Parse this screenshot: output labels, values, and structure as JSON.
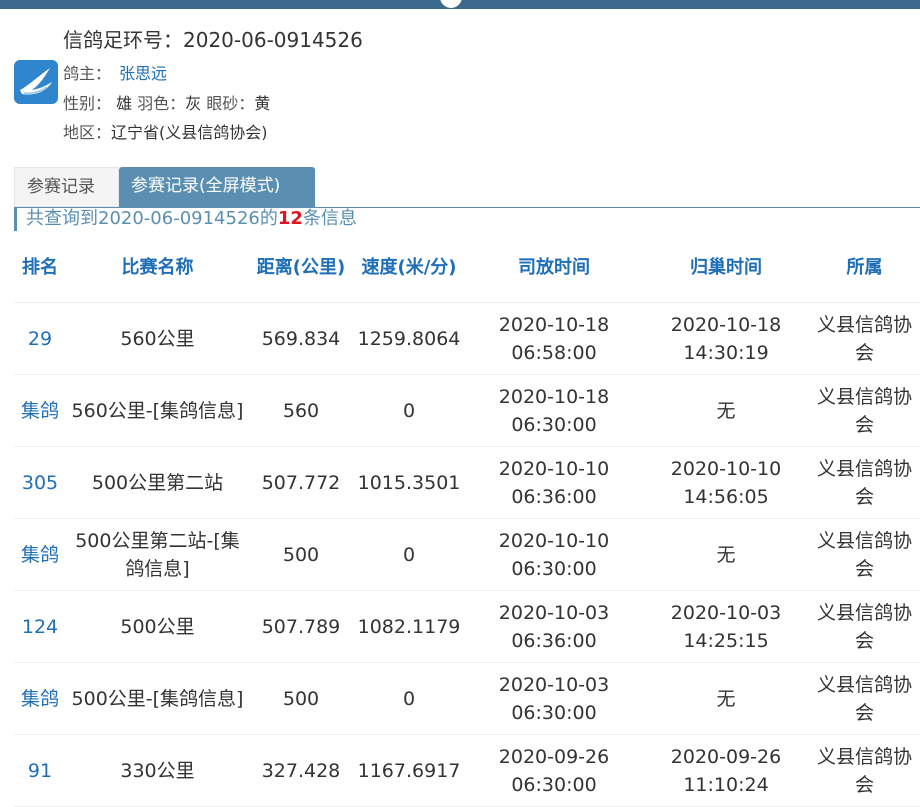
{
  "header": {
    "ring_label": "信鸽足环号：",
    "ring_number": "2020-06-0914526",
    "owner_label": "鸽主：",
    "owner_name": "张思远",
    "sex_label": "性别：",
    "sex_value": "雄",
    "color_label": "羽色：",
    "color_value": "灰",
    "eye_label": "眼砂：",
    "eye_value": "黄",
    "region_label": "地区：",
    "region_value": "辽宁省(义县信鸽协会)",
    "logo_icon": "dove-logo-icon"
  },
  "tabs": [
    {
      "label": "参赛记录",
      "active": false
    },
    {
      "label": "参赛记录(全屏模式)",
      "active": true
    }
  ],
  "query": {
    "prefix": "共查询到2020-06-0914526的",
    "count": "12",
    "suffix": "条信息"
  },
  "table": {
    "columns": [
      "排名",
      "比赛名称",
      "距离(公里)",
      "速度(米/分)",
      "司放时间",
      "归巢时间",
      "所属"
    ],
    "rows": [
      {
        "rank": "29",
        "race": "560公里",
        "distance": "569.834",
        "speed": "1259.8064",
        "release": "2020-10-18 06:58:00",
        "arrival": "2020-10-18 14:30:19",
        "org": "义县信鸽协会"
      },
      {
        "rank": "集鸽",
        "race": "560公里-[集鸽信息]",
        "distance": "560",
        "speed": "0",
        "release": "2020-10-18 06:30:00",
        "arrival": "无",
        "org": "义县信鸽协会"
      },
      {
        "rank": "305",
        "race": "500公里第二站",
        "distance": "507.772",
        "speed": "1015.3501",
        "release": "2020-10-10 06:36:00",
        "arrival": "2020-10-10 14:56:05",
        "org": "义县信鸽协会"
      },
      {
        "rank": "集鸽",
        "race": "500公里第二站-[集鸽信息]",
        "distance": "500",
        "speed": "0",
        "release": "2020-10-10 06:30:00",
        "arrival": "无",
        "org": "义县信鸽协会"
      },
      {
        "rank": "124",
        "race": "500公里",
        "distance": "507.789",
        "speed": "1082.1179",
        "release": "2020-10-03 06:36:00",
        "arrival": "2020-10-03 14:25:15",
        "org": "义县信鸽协会"
      },
      {
        "rank": "集鸽",
        "race": "500公里-[集鸽信息]",
        "distance": "500",
        "speed": "0",
        "release": "2020-10-03 06:30:00",
        "arrival": "无",
        "org": "义县信鸽协会"
      },
      {
        "rank": "91",
        "race": "330公里",
        "distance": "327.428",
        "speed": "1167.6917",
        "release": "2020-09-26 06:30:00",
        "arrival": "2020-09-26 11:10:24",
        "org": "义县信鸽协会"
      }
    ]
  },
  "colors": {
    "accent": "#5b8fb2",
    "link": "#1f6fb8",
    "highlight": "#e0141e"
  }
}
